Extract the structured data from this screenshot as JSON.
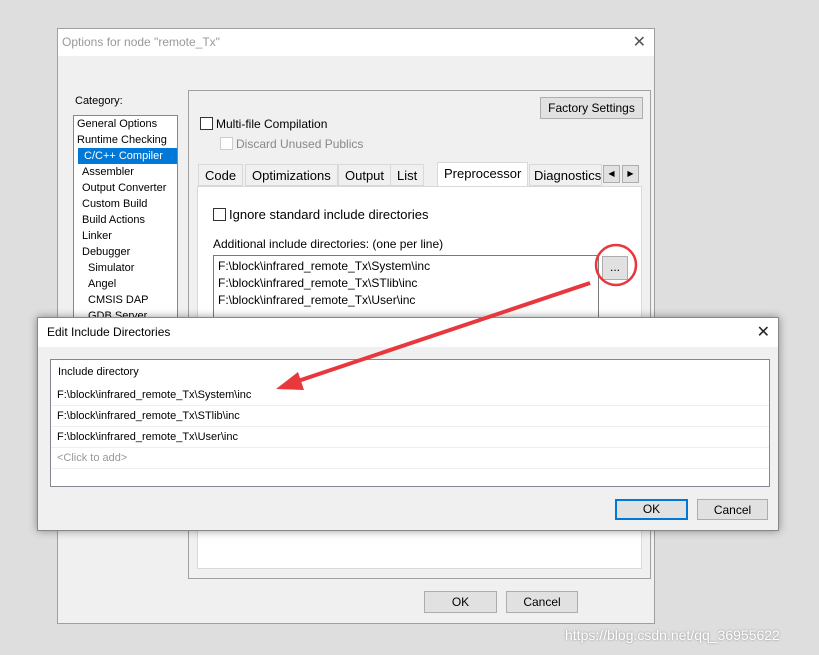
{
  "main_dialog": {
    "title": "Options for node \"remote_Tx\"",
    "category_label": "Category:",
    "categories": [
      "General Options",
      "Runtime Checking",
      "C/C++ Compiler",
      "Assembler",
      "Output Converter",
      "Custom Build",
      "Build Actions",
      "Linker",
      "Debugger",
      "Simulator",
      "Angel",
      "CMSIS DAP",
      "GDB Server"
    ],
    "selected_category": "C/C++ Compiler",
    "factory_settings": "Factory Settings",
    "multi_file": "Multi-file Compilation",
    "discard_unused": "Discard Unused Publics",
    "tabs": [
      "Code",
      "Optimizations",
      "Output",
      "List",
      "Preprocessor",
      "Diagnostics"
    ],
    "active_tab": "Preprocessor",
    "ignore_std": "Ignore standard include directories",
    "additional_label": "Additional include directories: (one per line)",
    "dirs": [
      "F:\\block\\infrared_remote_Tx\\System\\inc",
      "F:\\block\\infrared_remote_Tx\\STlib\\inc",
      "F:\\block\\infrared_remote_Tx\\User\\inc"
    ],
    "browse": "...",
    "ok": "OK",
    "cancel": "Cancel"
  },
  "edit_dialog": {
    "title": "Edit Include Directories",
    "header": "Include directory",
    "rows": [
      "F:\\block\\infrared_remote_Tx\\System\\inc",
      "F:\\block\\infrared_remote_Tx\\STlib\\inc",
      "F:\\block\\infrared_remote_Tx\\User\\inc"
    ],
    "add_placeholder": "<Click to add>",
    "ok": "OK",
    "cancel": "Cancel"
  },
  "annotation_color": "#e8383d",
  "watermark": "https://blog.csdn.net/qq_36955622"
}
